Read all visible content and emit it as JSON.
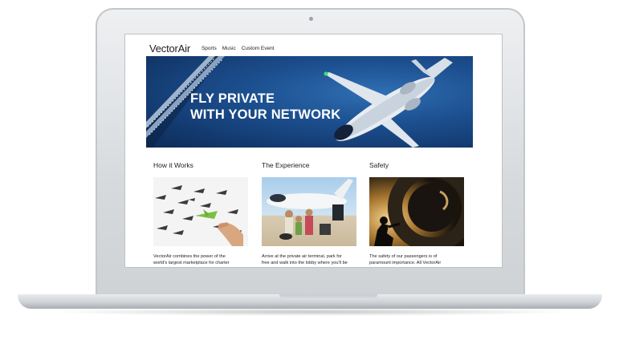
{
  "site": {
    "brand": "VectorAir",
    "nav": [
      "Sports",
      "Music",
      "Custom Event"
    ]
  },
  "hero": {
    "headline_line1": "FLY PRIVATE",
    "headline_line2": "WITH YOUR NETWORK"
  },
  "sections": [
    {
      "title": "How it Works",
      "text_line1": "VectorAir combines the power of the",
      "text_line2": "world's largest marketplace for charter"
    },
    {
      "title": "The Experience",
      "text_line1": "Arrive at the private air terminal, park for",
      "text_line2": "free and walk into the lobby where you'll be"
    },
    {
      "title": "Safety",
      "text_line1": "The safety of our passengers is of",
      "text_line2": "paramount importance. All VectorAir"
    }
  ],
  "colors": {
    "hero_blue": "#1c4f8f",
    "accent_green": "#7bc043",
    "laptop_silver": "#d7dadd"
  }
}
